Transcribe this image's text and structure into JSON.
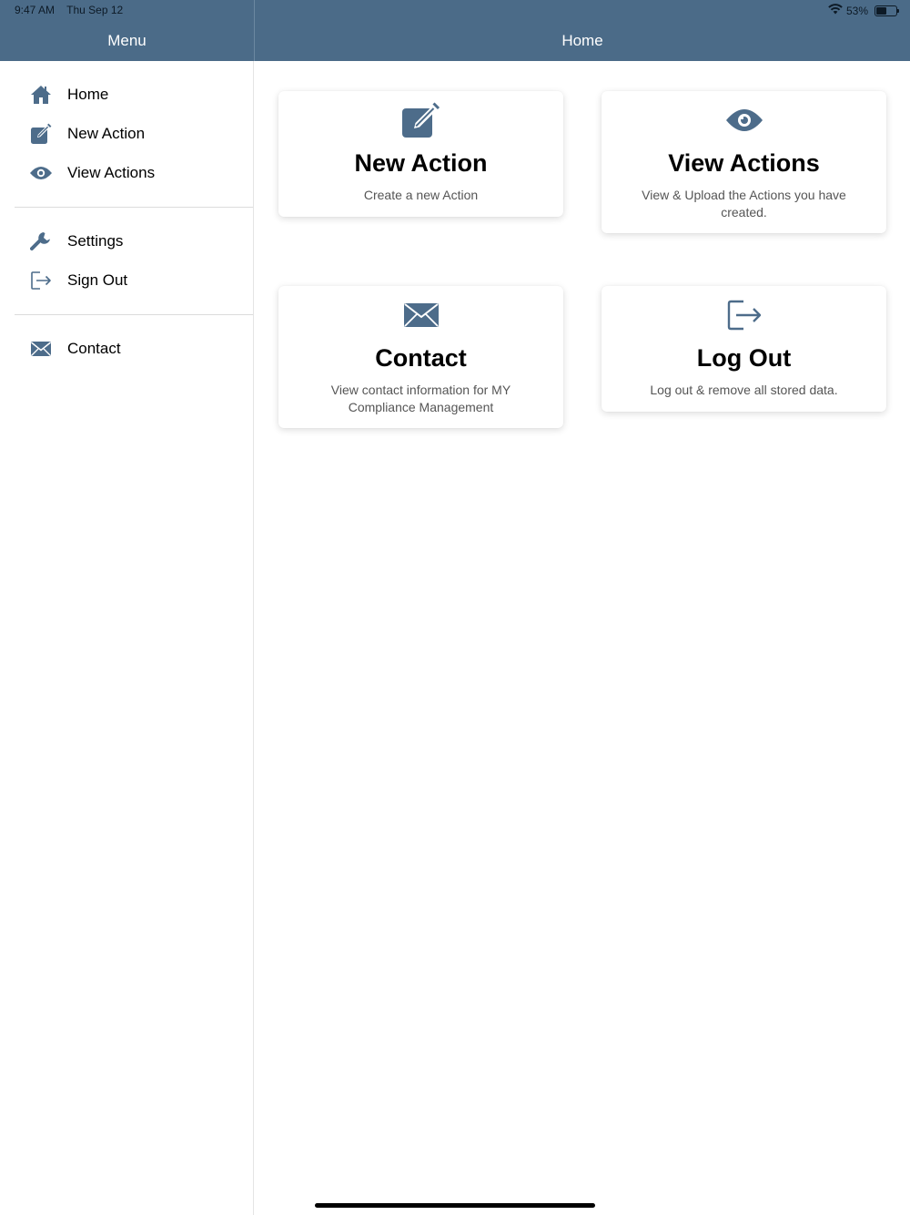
{
  "status_bar": {
    "time": "9:47 AM",
    "date": "Thu Sep 12",
    "battery": "53%",
    "battery_level": 0.53
  },
  "sidebar": {
    "title": "Menu",
    "groups": [
      {
        "items": [
          {
            "label": "Home",
            "icon": "home-icon"
          },
          {
            "label": "New Action",
            "icon": "edit-icon"
          },
          {
            "label": "View Actions",
            "icon": "eye-icon"
          }
        ]
      },
      {
        "items": [
          {
            "label": "Settings",
            "icon": "wrench-icon"
          },
          {
            "label": "Sign Out",
            "icon": "sign-out-icon"
          }
        ]
      },
      {
        "items": [
          {
            "label": "Contact",
            "icon": "envelope-icon"
          }
        ]
      }
    ]
  },
  "header": {
    "title": "Home"
  },
  "cards": [
    {
      "title": "New Action",
      "description": "Create a new Action",
      "icon": "edit-icon"
    },
    {
      "title": "View Actions",
      "description": "View & Upload the Actions you have created.",
      "icon": "eye-icon"
    },
    {
      "title": "Contact",
      "description": "View contact information for MY Compliance Management",
      "icon": "envelope-icon"
    },
    {
      "title": "Log Out",
      "description": "Log out & remove all stored data.",
      "icon": "sign-out-icon"
    }
  ],
  "colors": {
    "accent": "#4b6b88",
    "icon": "#4d6c8a"
  }
}
